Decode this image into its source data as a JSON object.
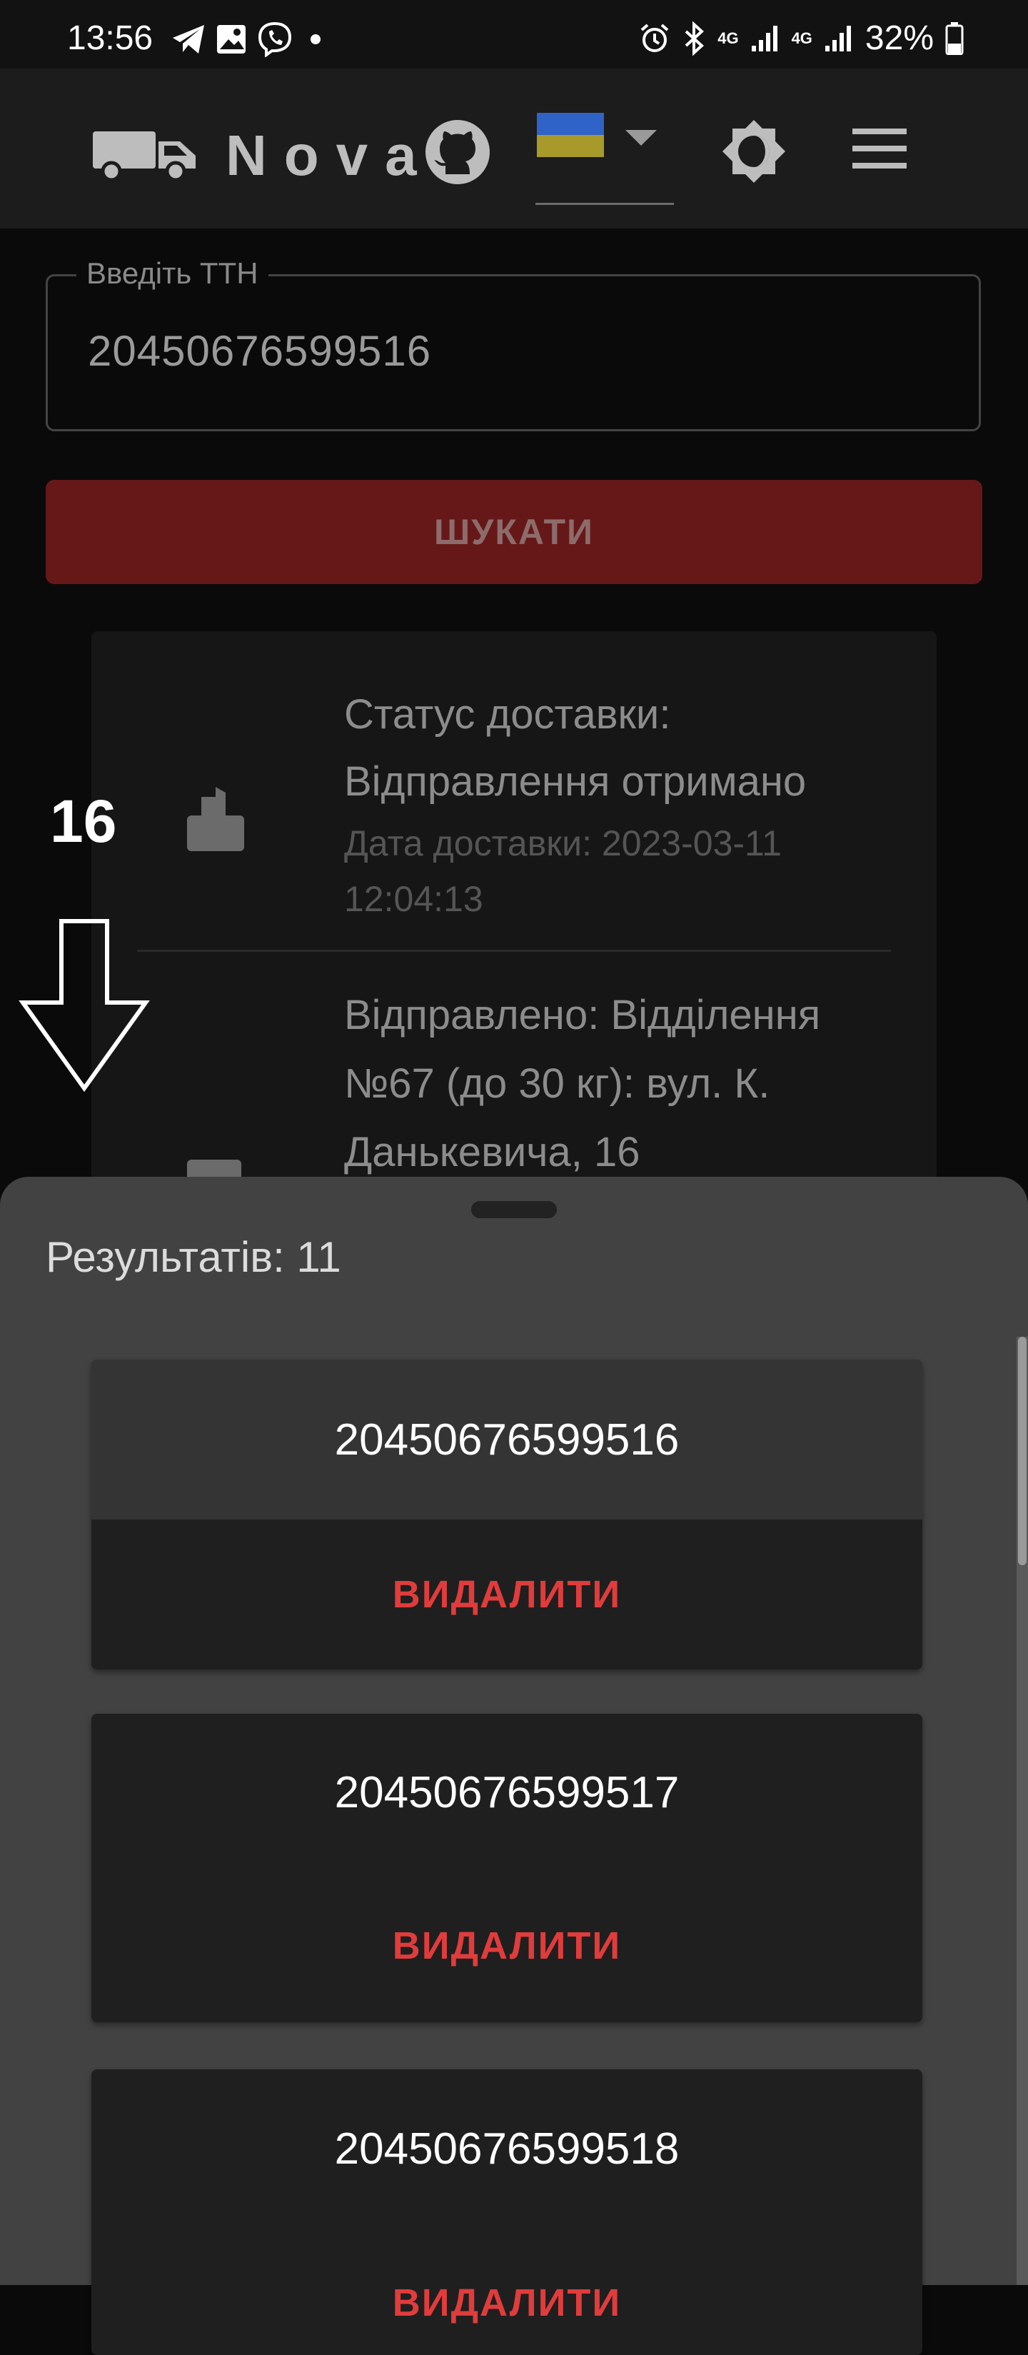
{
  "status_bar": {
    "time": "13:56",
    "battery": "32%",
    "network": [
      "4G",
      "4G"
    ]
  },
  "app_bar": {
    "logo_text": "Nova",
    "language_flag": "ukraine-flag",
    "colors": {
      "flag_top": "#2f63c8",
      "flag_bottom": "#a89a2a"
    }
  },
  "search": {
    "label": "Введіть ТТН",
    "value": "20450676599516",
    "button_label": "ШУКАТИ"
  },
  "timeline": [
    {
      "title": "Статус доставки: Відправлення отримано",
      "subtitle": "Дата доставки: 2023-03-11 12:04:13",
      "icon": "package-open-icon"
    },
    {
      "title": "Відправлено: Відділення №67 (до 30 кг): вул. К. Данькевича, 16",
      "icon": "package-send-icon"
    }
  ],
  "overlay": {
    "number": "16",
    "arrow": "down-arrow-icon"
  },
  "results_sheet": {
    "results_text": "Результатів: 11",
    "items": [
      {
        "number": "20450676599516",
        "delete_label": "ВИДАЛИТИ"
      },
      {
        "number": "20450676599517",
        "delete_label": "ВИДАЛИТИ"
      },
      {
        "number": "20450676599518",
        "delete_label": "ВИДАЛИТИ"
      }
    ]
  },
  "colors": {
    "accent_red": "#e03c3c",
    "search_button": "#661818",
    "sheet_bg": "#424242"
  }
}
